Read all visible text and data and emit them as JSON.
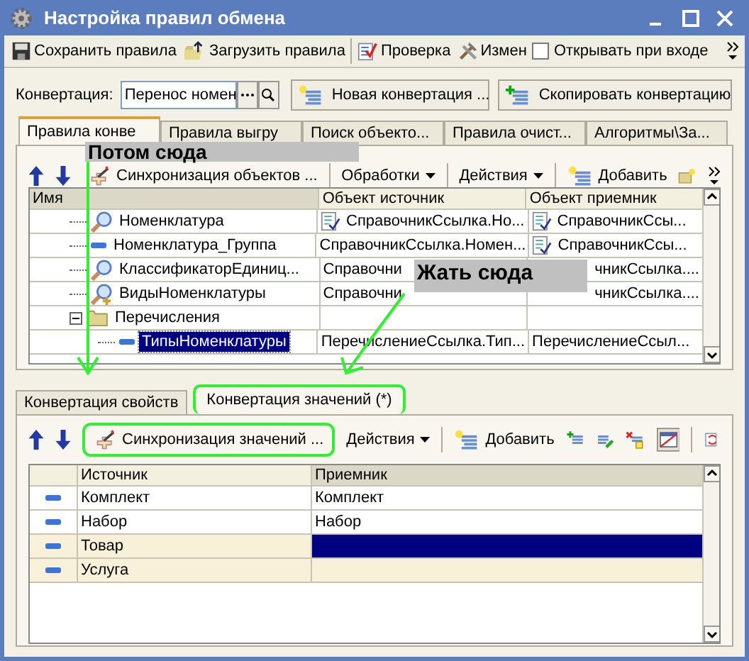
{
  "window": {
    "title": "Настройка правил обмена"
  },
  "toolbar": {
    "buttons": [
      {
        "kind": "save",
        "label": "Сохранить правила"
      },
      {
        "kind": "load",
        "label": "Загрузить правила"
      },
      {
        "kind": "check",
        "label": "Проверка"
      },
      {
        "kind": "tools",
        "label": "Измен"
      }
    ],
    "checkbox": {
      "label": "Открывать при входе",
      "checked": false
    }
  },
  "conversion": {
    "label": "Конвертация:",
    "value": "Перенос номен",
    "buttons": [
      {
        "kind": "new",
        "label": "Новая конвертация ..."
      },
      {
        "kind": "copy",
        "label": "Скопировать конвертацию"
      }
    ]
  },
  "tabs": [
    {
      "label": "Правила конве",
      "selected": true
    },
    {
      "label": "Правила выгру",
      "selected": false
    },
    {
      "label": "Поиск объекто...",
      "selected": false
    },
    {
      "label": "Правила очист...",
      "selected": false
    },
    {
      "label": "Алгоритмы\\За...",
      "selected": false
    }
  ],
  "rules_toolbar": {
    "sync": "Синхронизация объектов ...",
    "menus": [
      "Обработки",
      "Действия"
    ],
    "add": "Добавить"
  },
  "rules_table": {
    "columns": [
      "Имя",
      "Объект источник",
      "Объект приемник"
    ],
    "rows": [
      {
        "kind": "search",
        "name": "Номенклатура",
        "source": "СправочникСсылка.Но...",
        "source_icon": true,
        "target": "СправочникСсы...",
        "target_icon": true,
        "target_covered": false,
        "selected": false
      },
      {
        "kind": "dash",
        "name": "Номенклатура_Группа",
        "source": "СправочникСсылка.Номен...",
        "source_icon": false,
        "target": "СправочникСсы...",
        "target_icon": true,
        "target_covered": false,
        "selected": false
      },
      {
        "kind": "search",
        "name": "КлассификаторЕдиниц...",
        "source": "Справочни",
        "source_icon": false,
        "target": "чникСсылка....",
        "target_icon": false,
        "target_covered": true,
        "selected": false
      },
      {
        "kind": "search-plus",
        "name": "ВидыНоменклатуры",
        "source": "Справочни",
        "source_icon": false,
        "target": "чникСсылка....",
        "target_icon": false,
        "target_covered": true,
        "selected": false
      },
      {
        "kind": "folder",
        "name": "Перечисления",
        "expanded": true,
        "selected": false,
        "children": [
          {
            "kind": "dash",
            "name": "ТипыНоменклатуры",
            "source": "ПеречислениеСсылка.Тип...",
            "source_icon": false,
            "target": "ПеречислениеСсыл...",
            "target_icon": false,
            "target_covered": false,
            "selected": true
          }
        ]
      }
    ]
  },
  "detail_tabs": [
    {
      "label": "Конвертация свойств",
      "selected": false,
      "highlighted": false
    },
    {
      "label": "Конвертация значений (*)",
      "selected": true,
      "highlighted": true
    }
  ],
  "values_toolbar": {
    "sync": "Синхронизация значений ...",
    "sync_highlighted": true,
    "menu": "Действия",
    "add": "Добавить"
  },
  "values_table": {
    "columns": [
      "Источник",
      "Приемник"
    ],
    "rows": [
      {
        "source": "Комплект",
        "target": "Комплект",
        "unmatched": false,
        "selected": false
      },
      {
        "source": "Набор",
        "target": "Набор",
        "unmatched": false,
        "selected": false
      },
      {
        "source": "Товар",
        "target": "",
        "unmatched": true,
        "selected": true
      },
      {
        "source": "Услуга",
        "target": "",
        "unmatched": true,
        "selected": false
      }
    ]
  },
  "annotations": [
    {
      "text": "Потом сюда"
    },
    {
      "text": "Жать сюда"
    }
  ]
}
